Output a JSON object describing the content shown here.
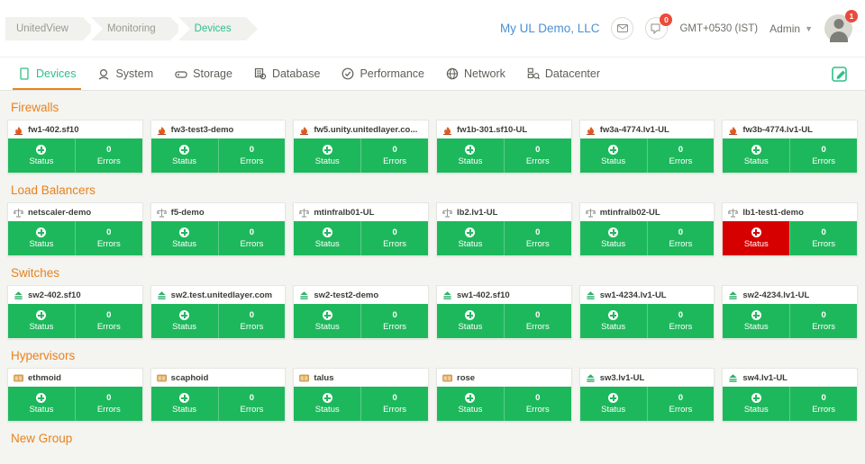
{
  "header": {
    "breadcrumb": [
      {
        "label": "UnitedView",
        "active": false
      },
      {
        "label": "Monitoring",
        "active": false
      },
      {
        "label": "Devices",
        "active": true
      }
    ],
    "company": "My UL Demo, LLC",
    "mail_icon": "envelope-icon",
    "notification_icon": "bell-icon",
    "notification_count": "0",
    "timezone": "GMT+0530 (IST)",
    "user_label": "Admin",
    "avatar_badge": "1"
  },
  "nav": {
    "tabs": [
      {
        "label": "Devices",
        "icon": "device-icon",
        "active": true
      },
      {
        "label": "System",
        "icon": "system-icon",
        "active": false
      },
      {
        "label": "Storage",
        "icon": "storage-icon",
        "active": false
      },
      {
        "label": "Database",
        "icon": "database-icon",
        "active": false
      },
      {
        "label": "Performance",
        "icon": "performance-icon",
        "active": false
      },
      {
        "label": "Network",
        "icon": "network-icon",
        "active": false
      },
      {
        "label": "Datacenter",
        "icon": "datacenter-icon",
        "active": false
      }
    ],
    "edit_icon": "edit-square-icon"
  },
  "labels": {
    "status": "Status",
    "errors": "Errors"
  },
  "colors": {
    "accent_orange": "#e8821e",
    "green": "#1eb85c",
    "red": "#d60000",
    "link_blue": "#4b90d3",
    "teal": "#2fc08a"
  },
  "groups": [
    {
      "title": "Firewalls",
      "icon": "firewall-icon",
      "cards": [
        {
          "name": "fw1-402.sf10",
          "errors": "0",
          "status_state": "ok"
        },
        {
          "name": "fw3-test3-demo",
          "errors": "0",
          "status_state": "ok"
        },
        {
          "name": "fw5.unity.unitedlayer.co...",
          "errors": "0",
          "status_state": "ok"
        },
        {
          "name": "fw1b-301.sf10-UL",
          "errors": "0",
          "status_state": "ok"
        },
        {
          "name": "fw3a-4774.lv1-UL",
          "errors": "0",
          "status_state": "ok"
        },
        {
          "name": "fw3b-4774.lv1-UL",
          "errors": "0",
          "status_state": "ok"
        }
      ]
    },
    {
      "title": "Load Balancers",
      "icon": "loadbalancer-icon",
      "cards": [
        {
          "name": "netscaler-demo",
          "errors": "0",
          "status_state": "ok"
        },
        {
          "name": "f5-demo",
          "errors": "0",
          "status_state": "ok"
        },
        {
          "name": "mtinfralb01-UL",
          "errors": "0",
          "status_state": "ok"
        },
        {
          "name": "lb2.lv1-UL",
          "errors": "0",
          "status_state": "ok"
        },
        {
          "name": "mtinfralb02-UL",
          "errors": "0",
          "status_state": "ok"
        },
        {
          "name": "lb1-test1-demo",
          "errors": "0",
          "status_state": "error"
        }
      ]
    },
    {
      "title": "Switches",
      "icon": "switch-icon",
      "cards": [
        {
          "name": "sw2-402.sf10",
          "errors": "0",
          "status_state": "ok"
        },
        {
          "name": "sw2.test.unitedlayer.com",
          "errors": "0",
          "status_state": "ok"
        },
        {
          "name": "sw2-test2-demo",
          "errors": "0",
          "status_state": "ok"
        },
        {
          "name": "sw1-402.sf10",
          "errors": "0",
          "status_state": "ok"
        },
        {
          "name": "sw1-4234.lv1-UL",
          "errors": "0",
          "status_state": "ok"
        },
        {
          "name": "sw2-4234.lv1-UL",
          "errors": "0",
          "status_state": "ok"
        }
      ]
    },
    {
      "title": "Hypervisors",
      "icon": "hypervisor-icon",
      "cards": [
        {
          "name": "ethmoid",
          "errors": "0",
          "status_state": "ok",
          "icon": "hypervisor-icon"
        },
        {
          "name": "scaphoid",
          "errors": "0",
          "status_state": "ok",
          "icon": "hypervisor-icon"
        },
        {
          "name": "talus",
          "errors": "0",
          "status_state": "ok",
          "icon": "hypervisor-icon"
        },
        {
          "name": "rose",
          "errors": "0",
          "status_state": "ok",
          "icon": "hypervisor-icon"
        },
        {
          "name": "sw3.lv1-UL",
          "errors": "0",
          "status_state": "ok",
          "icon": "switch-icon"
        },
        {
          "name": "sw4.lv1-UL",
          "errors": "0",
          "status_state": "ok",
          "icon": "switch-icon"
        }
      ]
    },
    {
      "title": "New Group",
      "icon": "none",
      "cards": []
    }
  ]
}
